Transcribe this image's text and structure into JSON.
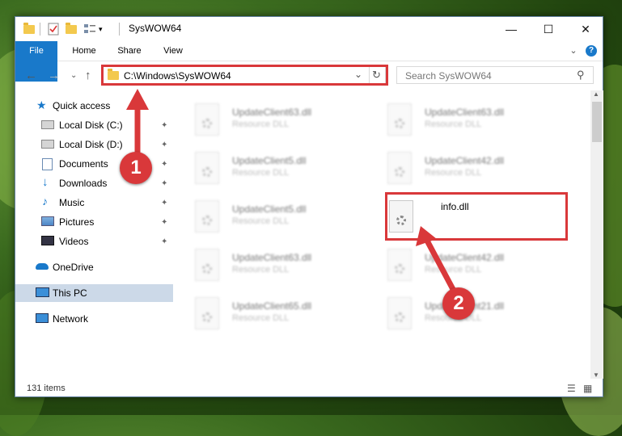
{
  "window": {
    "title": "SysWOW64",
    "minimize_glyph": "—",
    "maximize_glyph": "☐",
    "close_glyph": "✕"
  },
  "ribbon": {
    "tabs": [
      {
        "label": "File"
      },
      {
        "label": "Home"
      },
      {
        "label": "Share"
      },
      {
        "label": "View"
      }
    ],
    "expand_glyph": "⌄",
    "help_glyph": "?"
  },
  "nav": {
    "back_glyph": "←",
    "forward_glyph": "→",
    "recent_glyph": "⌄",
    "up_glyph": "↑",
    "address": "C:\\Windows\\SysWOW64",
    "address_dropdown_glyph": "⌄",
    "refresh_glyph": "↻",
    "search_placeholder": "Search SysWOW64",
    "search_glyph": "⚲"
  },
  "sidebar": {
    "items": [
      {
        "label": "Quick access",
        "icon": "star-icon"
      },
      {
        "label": "Local Disk (C:)",
        "icon": "drive-icon",
        "pinned": true
      },
      {
        "label": "Local Disk (D:)",
        "icon": "drive-icon",
        "pinned": true
      },
      {
        "label": "Documents",
        "icon": "documents-icon",
        "pinned": true
      },
      {
        "label": "Downloads",
        "icon": "download-icon",
        "pinned": true
      },
      {
        "label": "Music",
        "icon": "music-icon",
        "pinned": true
      },
      {
        "label": "Pictures",
        "icon": "pictures-icon",
        "pinned": true
      },
      {
        "label": "Videos",
        "icon": "videos-icon",
        "pinned": true
      },
      {
        "label": "OneDrive",
        "icon": "cloud-icon"
      },
      {
        "label": "This PC",
        "icon": "computer-icon",
        "selected": true
      },
      {
        "label": "Network",
        "icon": "network-icon"
      }
    ],
    "pin_glyph": "📌"
  },
  "files": [
    {
      "name": "UpdateClient63.dll",
      "type": "Resource DLL",
      "blurred": true
    },
    {
      "name": "UpdateClient63.dll",
      "type": "Resource DLL",
      "blurred": true
    },
    {
      "name": "UpdateClient5.dll",
      "type": "Resource DLL",
      "blurred": true
    },
    {
      "name": "UpdateClient42.dll",
      "type": "Resource DLL",
      "blurred": true
    },
    {
      "name": "UpdateClient5.dll",
      "type": "Resource DLL",
      "blurred": true
    },
    {
      "name": "info.dll",
      "type": "",
      "blurred": false
    },
    {
      "name": "UpdateClient63.dll",
      "type": "Resource DLL",
      "blurred": true
    },
    {
      "name": "UpdateClient42.dll",
      "type": "Resource DLL",
      "blurred": true
    },
    {
      "name": "UpdateClient65.dll",
      "type": "Resource DLL",
      "blurred": true
    },
    {
      "name": "UpdateClient21.dll",
      "type": "Resource DLL",
      "blurred": true
    }
  ],
  "status": {
    "item_count": "131 items"
  },
  "annotations": {
    "step1": "1",
    "step2": "2",
    "color": "#d9383a"
  }
}
